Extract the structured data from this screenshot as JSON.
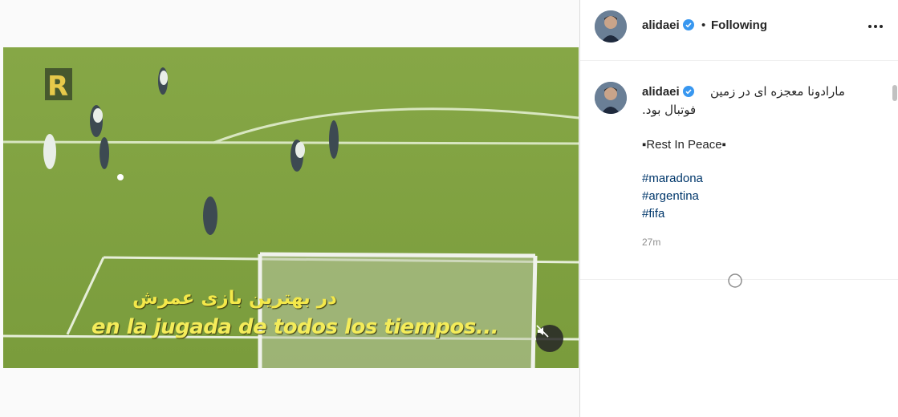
{
  "video": {
    "scoreboard_letter": "R",
    "subtitle_fa": "در بهترین بازی عمرش",
    "subtitle_es": "en la jugada de todos los tiempos...",
    "mute_icon": "speaker-muted-icon"
  },
  "header": {
    "username": "alidaei",
    "verified_icon": "verified-badge-icon",
    "separator": "•",
    "follow_status": "Following",
    "more_icon": "more-options-icon"
  },
  "caption": {
    "username": "alidaei",
    "text_fa_line1": "مارادونا معجزه ای در زمین",
    "text_fa_line2": "فوتبال بود.",
    "rest_in_peace": "▪Rest In Peace▪",
    "hashtags": [
      "#maradona",
      "#argentina",
      "#fifa"
    ],
    "time": "27m"
  },
  "colors": {
    "link": "#00376b",
    "verified": "#3897f0",
    "pitch": "#7da03f",
    "subtitle": "#f4ec5a"
  }
}
